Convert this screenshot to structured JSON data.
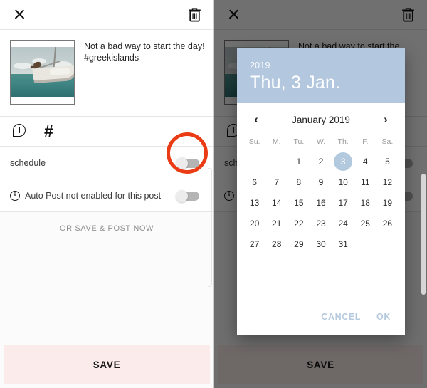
{
  "colors": {
    "accent_blue": "#b3c8de",
    "annotation_red": "#ea3b14",
    "save_bg": "#fbeceb",
    "dim_overlay": "rgba(0,0,0,0.56)"
  },
  "topbar": {
    "close_icon": "close-x-icon",
    "delete_icon": "trash-can-icon"
  },
  "post": {
    "caption": "Not a bad way to start the day! #greekislands",
    "thumbnail_alt": "sailboat-on-teal-sea-photo"
  },
  "tools": {
    "add_comment_icon": "comment-bubble-plus-icon",
    "hashtag_icon": "#"
  },
  "options": [
    {
      "label": "schedule",
      "toggle_state": "off",
      "has_info_icon": false
    },
    {
      "label": "Auto Post not enabled for this post",
      "toggle_state": "off",
      "has_info_icon": true
    }
  ],
  "or_save_text": "OR SAVE & POST NOW",
  "save_button": {
    "label": "SAVE"
  },
  "datepicker": {
    "year": "2019",
    "selected_date_text": "Thu, 3 Jan.",
    "month_title": "January 2019",
    "prev_icon": "chevron-left-icon",
    "next_icon": "chevron-right-icon",
    "day_headers": [
      "Su.",
      "M.",
      "Tu.",
      "W.",
      "Th.",
      "F.",
      "Sa."
    ],
    "leading_blanks": 2,
    "days": [
      1,
      2,
      3,
      4,
      5,
      6,
      7,
      8,
      9,
      10,
      11,
      12,
      13,
      14,
      15,
      16,
      17,
      18,
      19,
      20,
      21,
      22,
      23,
      24,
      25,
      26,
      27,
      28,
      29,
      30,
      31
    ],
    "selected_day": 3,
    "cancel_label": "CANCEL",
    "ok_label": "OK"
  }
}
